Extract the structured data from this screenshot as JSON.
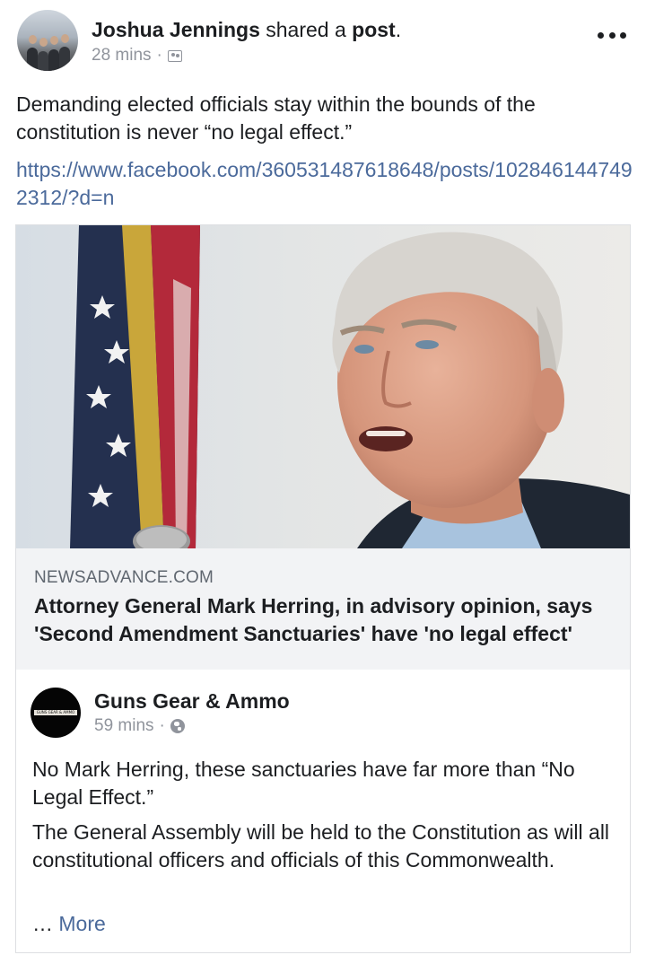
{
  "header": {
    "author_name": "Joshua Jennings",
    "action": "shared a",
    "object": "post",
    "object_suffix": ".",
    "time": "28 mins",
    "separator": "·",
    "audience_icon": "friends-icon",
    "menu_icon": "more-options-icon"
  },
  "post": {
    "text": "Demanding elected officials stay within the bounds of the constitution is never “no legal effect.”",
    "link": "https://www.facebook.com/360531487618648/posts/1028461447492312/?d=n"
  },
  "shared": {
    "link_preview": {
      "domain": "NEWSADVANCE.COM",
      "headline": "Attorney General Mark Herring, in advisory opinion, says 'Second Amendment Sanctuaries' have 'no legal effect'"
    },
    "page": {
      "name": "Guns Gear & Ammo",
      "avatar_text": "GUNS GEAR & AMMO",
      "time": "59 mins",
      "separator": "·",
      "audience_icon": "globe-icon"
    },
    "body": {
      "paragraph1": "No Mark Herring, these sanctuaries have far more than “No Legal Effect.”",
      "paragraph2": "The General Assembly will be held to the Constitution as will all constitutional officers and officials of this Commonwealth.",
      "ellipsis": "…",
      "more_label": "More"
    }
  },
  "colors": {
    "text": "#1c1e21",
    "meta": "#90949c",
    "link": "#4b6a9b",
    "preview_bg": "#f2f3f5",
    "border": "#dddfe2"
  }
}
